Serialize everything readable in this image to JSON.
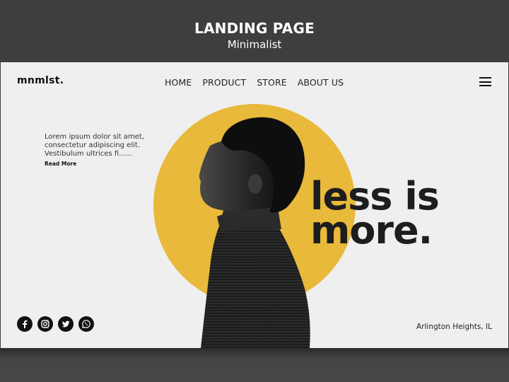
{
  "presentation": {
    "title": "LANDING PAGE",
    "subtitle": "Minimalist"
  },
  "site": {
    "logo": "mnmlst.",
    "nav": [
      "HOME",
      "PRODUCT",
      "STORE",
      "ABOUT US"
    ],
    "menu_icon": "hamburger-icon",
    "intro_text": "Lorem ipsum dolor sit amet, consectetur adipiscing elit. Vestibulum ultrices fi......",
    "read_more": "Read More",
    "headline_line1": "less is",
    "headline_line2": "more.",
    "location": "Arlington Heights, IL",
    "social": [
      "facebook-icon",
      "instagram-icon",
      "twitter-icon",
      "whatsapp-icon"
    ],
    "colors": {
      "accent": "#e8b93a",
      "background": "#efefef",
      "text": "#1d1d1d",
      "frame": "#3e3e3e"
    }
  }
}
